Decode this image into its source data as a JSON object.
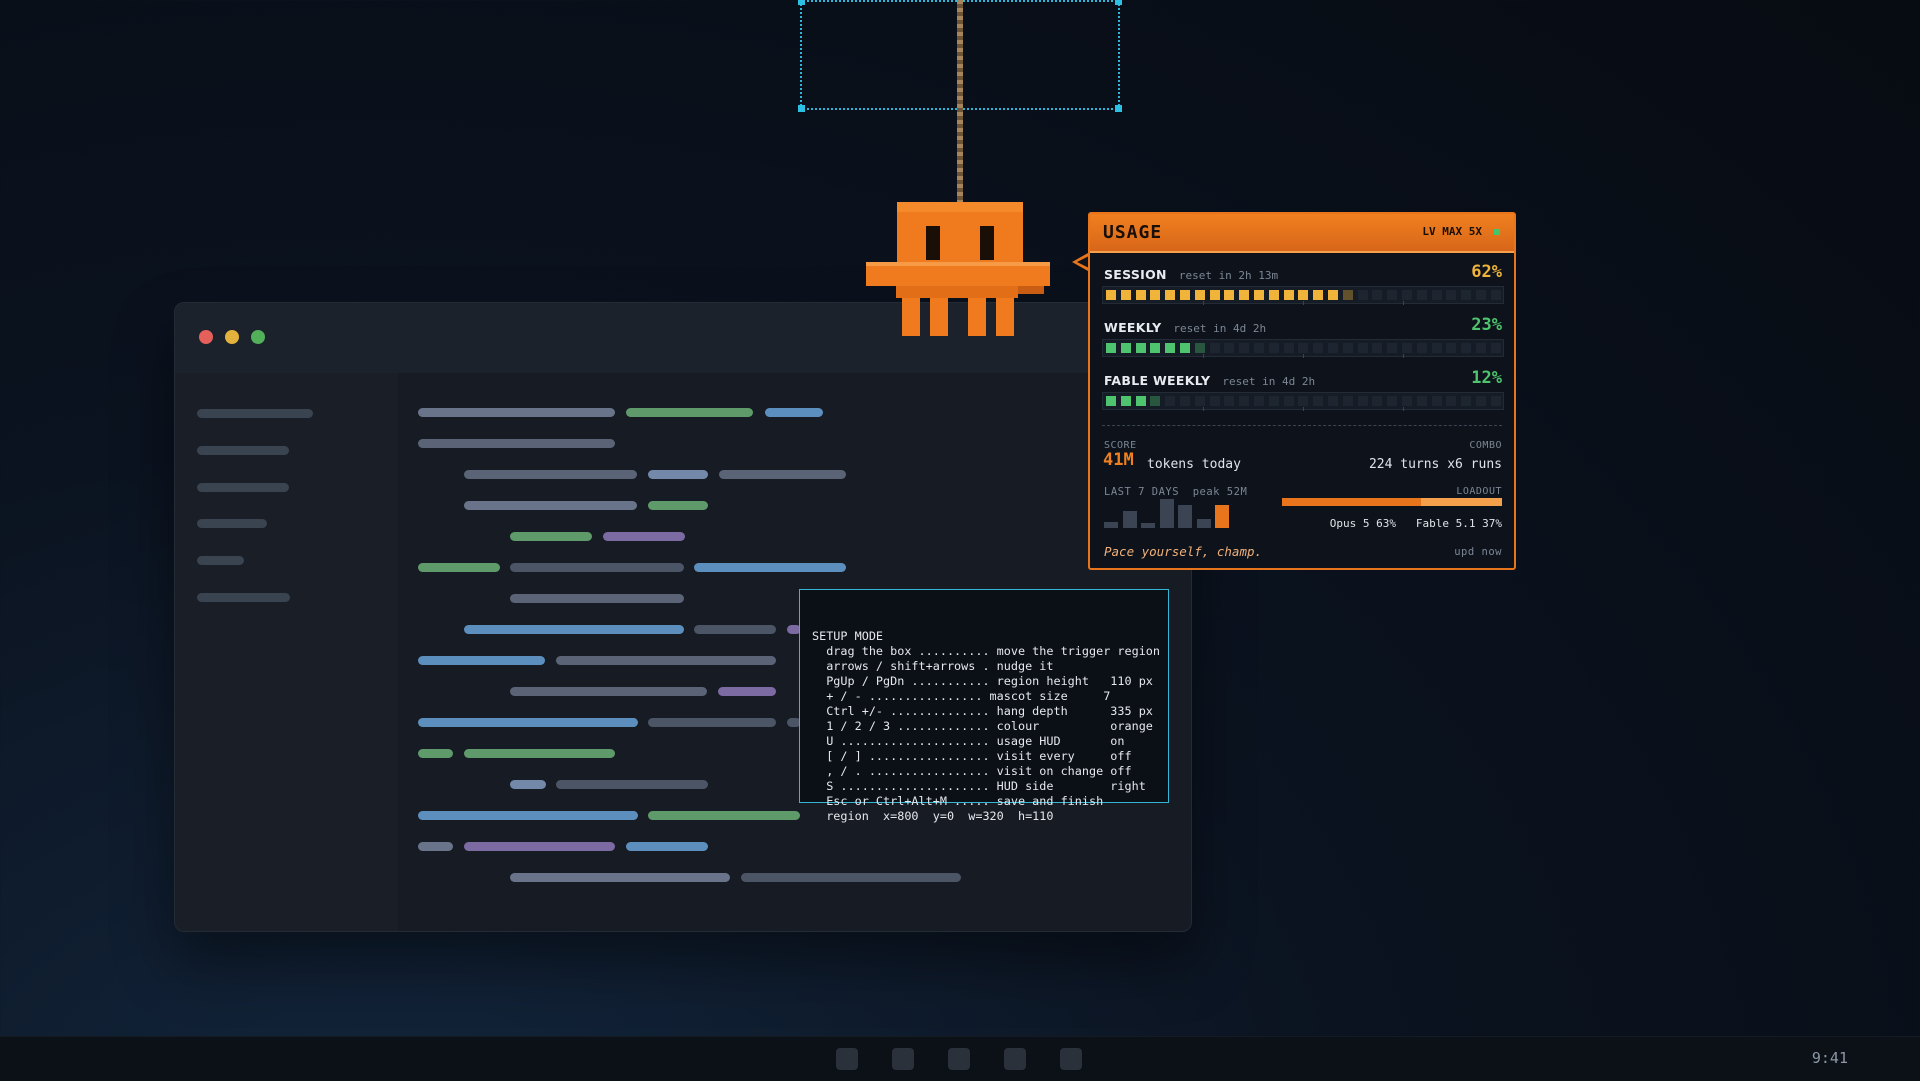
{
  "setup": {
    "text": "SETUP MODE\n  drag the box .......... move the trigger region\n  arrows / shift+arrows . nudge it\n  PgUp / PgDn ........... region height   110 px\n  + / - ................ mascot size     7\n  Ctrl +/- .............. hang depth      335 px\n  1 / 2 / 3 ............. colour          orange\n  U ..................... usage HUD       on\n  [ / ] ................. visit every     off\n  , / . ................. visit on change off\n  S ..................... HUD side        right\n  Esc or Ctrl+Alt+M ..... save and finish\n  region  x=800  y=0  w=320  h=110"
  },
  "hud": {
    "title": "USAGE",
    "plan": "LV MAX 5X",
    "meters": [
      {
        "label": "SESSION",
        "reset": "reset in 2h 13m",
        "pct_text": "62%",
        "percent": 62,
        "color": "#f0b43a"
      },
      {
        "label": "WEEKLY",
        "reset": "reset in 4d 2h",
        "pct_text": "23%",
        "percent": 23,
        "color": "#4ec46e"
      },
      {
        "label": "FABLE WEEKLY",
        "reset": "reset in 4d 2h",
        "pct_text": "12%",
        "percent": 12,
        "color": "#4ec46e"
      }
    ],
    "score_label": "SCORE",
    "score_value": "41M",
    "score_suffix": "tokens today",
    "combo_label": "COMBO",
    "combo_value": "224 turns  x6 runs",
    "last7_label": "LAST 7 DAYS",
    "peak_label": "peak 52M",
    "last7_values": [
      8,
      22,
      6,
      38,
      30,
      12,
      30
    ],
    "last7_peak": 52,
    "loadout_label": "LOADOUT",
    "loadout": [
      {
        "name": "Opus 5",
        "pct": 63
      },
      {
        "name": "Fable 5.1",
        "pct": 37
      }
    ],
    "loadout_text_1": "Opus 5 63%",
    "loadout_text_2": "Fable 5.1 37%",
    "tagline": "Pace yourself, champ.",
    "updated": "upd now"
  },
  "taskbar": {
    "clock": "9:41"
  },
  "colors": {
    "accent": "#e8741c",
    "selection": "#2bb6d9",
    "session": "#f0b43a",
    "weekly": "#4ec46e"
  }
}
